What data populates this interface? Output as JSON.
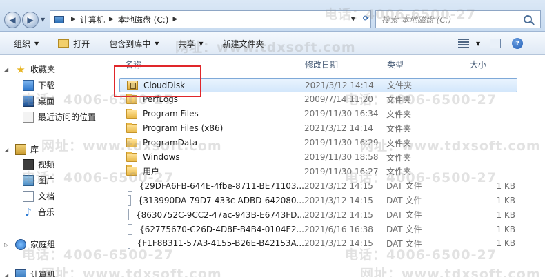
{
  "address": {
    "crumbs": [
      "计算机",
      "本地磁盘 (C:)"
    ]
  },
  "search": {
    "placeholder": "搜索 本地磁盘 (C:)"
  },
  "toolbar": {
    "organize": "组织",
    "open": "打开",
    "include_library": "包含到库中",
    "share": "共享",
    "new_folder": "新建文件夹"
  },
  "sidebar": {
    "favorites": "收藏夹",
    "downloads": "下载",
    "desktop": "桌面",
    "recent": "最近访问的位置",
    "libraries": "库",
    "videos": "视频",
    "pictures": "图片",
    "documents": "文档",
    "music": "音乐",
    "homegroup": "家庭组",
    "computer": "计算机"
  },
  "columns": {
    "name": "名称",
    "date": "修改日期",
    "type": "类型",
    "size": "大小"
  },
  "rows": [
    {
      "name": "CloudDisk",
      "date": "2021/3/12 14:14",
      "type": "文件夹",
      "size": "",
      "icon": "locked-folder-icon"
    },
    {
      "name": "PerfLogs",
      "date": "2009/7/14 11:20",
      "type": "文件夹",
      "size": "",
      "icon": "folder-icon"
    },
    {
      "name": "Program Files",
      "date": "2019/11/30 16:34",
      "type": "文件夹",
      "size": "",
      "icon": "folder-icon"
    },
    {
      "name": "Program Files (x86)",
      "date": "2021/3/12 14:14",
      "type": "文件夹",
      "size": "",
      "icon": "folder-icon"
    },
    {
      "name": "ProgramData",
      "date": "2019/11/30 16:29",
      "type": "文件夹",
      "size": "",
      "icon": "folder-icon"
    },
    {
      "name": "Windows",
      "date": "2019/11/30 18:58",
      "type": "文件夹",
      "size": "",
      "icon": "folder-icon"
    },
    {
      "name": "用户",
      "date": "2019/11/30 16:27",
      "type": "文件夹",
      "size": "",
      "icon": "folder-icon"
    },
    {
      "name": "{29DFA6FB-644E-4fbe-8711-BE71103...",
      "date": "2021/3/12 14:15",
      "type": "DAT 文件",
      "size": "1 KB",
      "icon": "file-icon"
    },
    {
      "name": "{313990DA-79D7-433c-ADBD-642080...",
      "date": "2021/3/12 14:15",
      "type": "DAT 文件",
      "size": "1 KB",
      "icon": "file-icon"
    },
    {
      "name": "{8630752C-9CC2-47ac-943B-E6743FD...",
      "date": "2021/3/12 14:15",
      "type": "DAT 文件",
      "size": "1 KB",
      "icon": "file-icon"
    },
    {
      "name": "{62775670-C26D-4D8F-B4B4-0104E2...",
      "date": "2021/6/16 16:38",
      "type": "DAT 文件",
      "size": "1 KB",
      "icon": "file-icon"
    },
    {
      "name": "{F1F88311-57A3-4155-B26E-B42153A...",
      "date": "2021/3/12 14:15",
      "type": "DAT 文件",
      "size": "1 KB",
      "icon": "file-icon"
    }
  ],
  "watermark": {
    "phone": "电话：4006-6500-27",
    "site": "网址：www.tdxsoft.com"
  },
  "colors": {
    "selection": "#d3e7fb",
    "annotation": "#e0262a",
    "accent": "#2a61a8"
  }
}
